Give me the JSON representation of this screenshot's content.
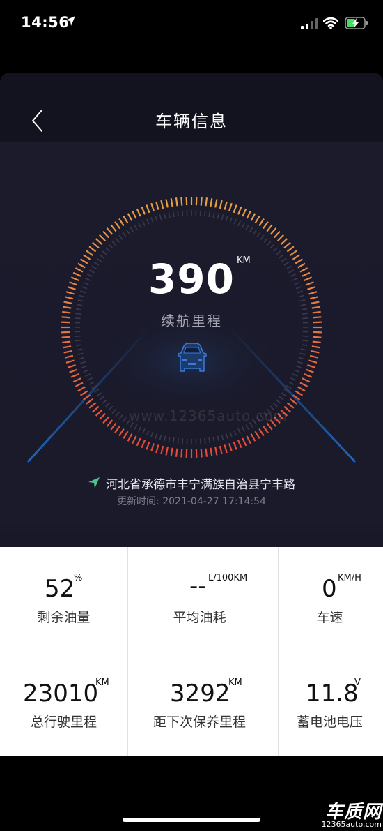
{
  "status_bar": {
    "time": "14:56"
  },
  "header": {
    "title": "车辆信息"
  },
  "range": {
    "value": "390",
    "unit": "KM",
    "label": "续航里程"
  },
  "watermark": "www.12365auto.com",
  "location": {
    "address": "河北省承德市丰宁满族自治县宁丰路",
    "updated": "更新时间: 2021-04-27 17:14:54"
  },
  "stats": {
    "fuel": {
      "value": "52",
      "unit": "%",
      "label": "剩余油量"
    },
    "consumption": {
      "value": "--",
      "unit": "L/100KM",
      "label": "平均油耗"
    },
    "speed": {
      "value": "0",
      "unit": "KM/H",
      "label": "车速"
    },
    "mileage": {
      "value": "23010",
      "unit": "KM",
      "label": "总行驶里程"
    },
    "maintenance": {
      "value": "3292",
      "unit": "KM",
      "label": "距下次保养里程"
    },
    "battery": {
      "value": "11.8",
      "unit": "V",
      "label": "蓄电池电压"
    }
  },
  "brand": {
    "name": "车质网",
    "url": "12365auto.com"
  },
  "colors": {
    "gauge_start": "#e8a046",
    "gauge_end": "#e24a3a",
    "accent_green": "#4cc38a",
    "car_blue": "#3d7bd8"
  }
}
